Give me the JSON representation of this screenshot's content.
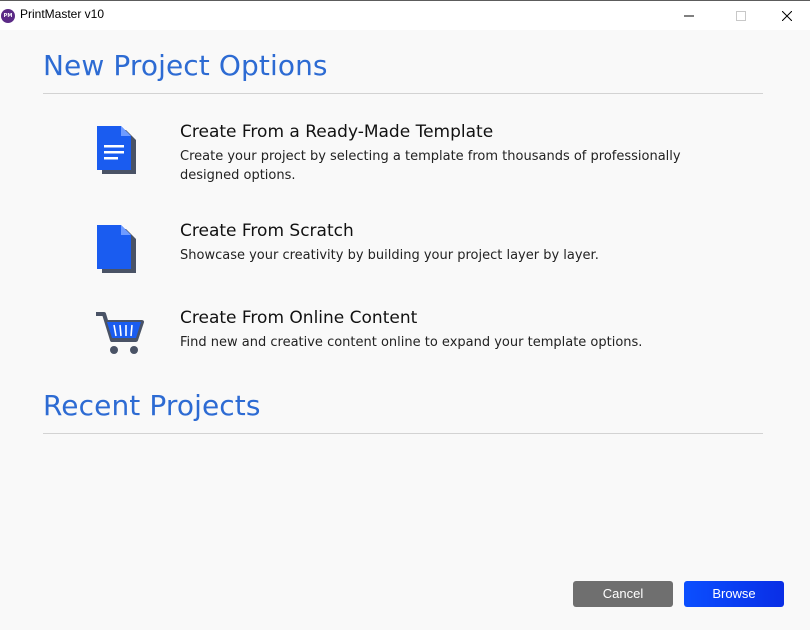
{
  "window": {
    "app_icon_text": "PM",
    "title": "PrintMaster v10"
  },
  "new_project": {
    "heading": "New Project Options",
    "options": [
      {
        "icon": "document-template-icon",
        "title": "Create From a Ready-Made Template",
        "description": "Create your project by selecting a template from thousands of professionally designed options."
      },
      {
        "icon": "blank-page-icon",
        "title": "Create From Scratch",
        "description": "Showcase your creativity by building your project layer by layer."
      },
      {
        "icon": "shopping-cart-icon",
        "title": "Create From Online Content",
        "description": "Find new and creative content online to expand your template options."
      }
    ]
  },
  "recent_projects": {
    "heading": "Recent Projects"
  },
  "footer": {
    "cancel_label": "Cancel",
    "browse_label": "Browse"
  },
  "colors": {
    "accent": "#2d6bd3",
    "icon_blue": "#1a5cf0",
    "icon_shadow": "#4a5366",
    "cancel_bg": "#6f6f6f",
    "browse_bg": "#0b4fff"
  }
}
